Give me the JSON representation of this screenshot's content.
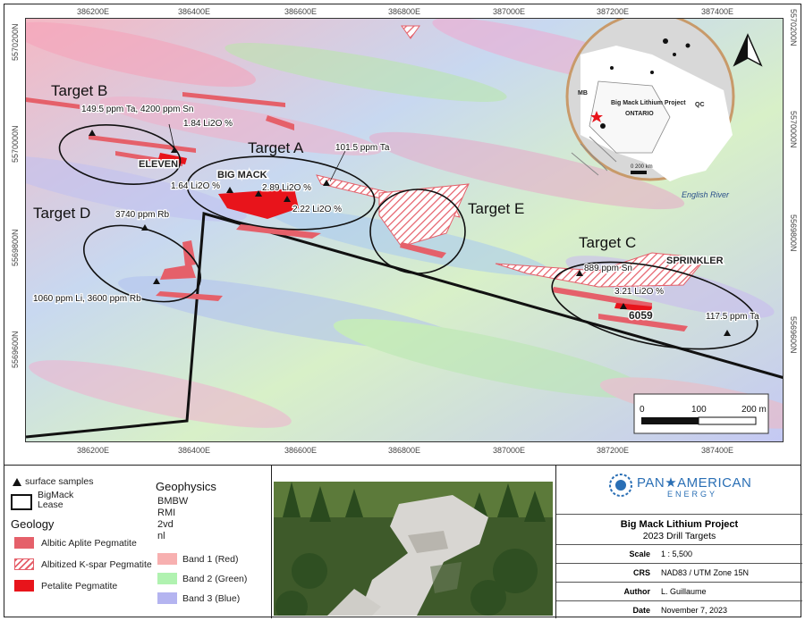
{
  "map": {
    "x_ticks_top": [
      "386200E",
      "386400E",
      "386600E",
      "386800E",
      "387000E",
      "387200E",
      "387400E"
    ],
    "x_ticks_bottom": [
      "386200E",
      "386400E",
      "386600E",
      "386800E",
      "387000E",
      "387200E",
      "387400E"
    ],
    "y_ticks_left": [
      "5570200N",
      "5570000N",
      "5569800N",
      "5569600N"
    ],
    "y_ticks_right": [
      "5570200N",
      "5570000N",
      "5569800N",
      "5569600N"
    ],
    "targets": [
      "Target B",
      "Target A",
      "Target E",
      "Target D",
      "Target C"
    ],
    "property_names": [
      "ELEVEN",
      "BIG MACK",
      "SPRINKLER",
      "6059"
    ],
    "sample_labels": {
      "b1": "149.5 ppm Ta, 4200 ppm Sn",
      "b2": "1.84 Li2O %",
      "a1": "101.5 ppm Ta",
      "a2": "1.64 Li2O %",
      "a3": "2.89 Li2O %",
      "a4": "2.22 Li2O %",
      "d1": "3740 ppm Rb",
      "d2": "1060 ppm Li, 3600 ppm Rb",
      "c1": "889 ppm Sn",
      "c2": "3.21 Li2O %",
      "c3": "117.5 ppm Ta"
    },
    "inset": {
      "labels": [
        "MB",
        "Big Mack Lithium Project",
        "ONTARIO",
        "QC"
      ],
      "scale_text": "0   200 km"
    },
    "river_label": "English River",
    "scale_bar": {
      "ticks": [
        "0",
        "100",
        "200 m"
      ]
    },
    "north_arrow": "north-arrow"
  },
  "legend": {
    "samples_label": "surface samples",
    "lease_label": "BigMack\nLease",
    "geology_title": "Geology",
    "geology_items": [
      "Albitic Aplite Pegmatite",
      "Albitized K-spar Pegmatite",
      "Petalite Pegmatite"
    ],
    "geophysics_title": "Geophysics",
    "geophysics_lines": [
      "BMBW",
      "RMI",
      "2vd",
      "nl"
    ],
    "bands": [
      "Band 1 (Red)",
      "Band 2 (Green)",
      "Band 3 (Blue)"
    ]
  },
  "title_block": {
    "company_line1": "PAN★AMERICAN",
    "company_line2": "ENERGY",
    "project": "Big Mack Lithium Project",
    "subtitle": "2023 Drill Targets",
    "rows": [
      {
        "key": "Scale",
        "value": "1 : 5,500"
      },
      {
        "key": "CRS",
        "value": "NAD83 / UTM Zone 15N"
      },
      {
        "key": "Author",
        "value": "L. Guillaume"
      },
      {
        "key": "Date",
        "value": "November 7, 2023"
      }
    ]
  },
  "colors": {
    "petalite": "#e8141b",
    "aplite": "#e5606a",
    "band1": "#f7b0b0",
    "band2": "#b0f2b0",
    "band3": "#b4b4f0",
    "brand_blue": "#2a6fb5"
  }
}
